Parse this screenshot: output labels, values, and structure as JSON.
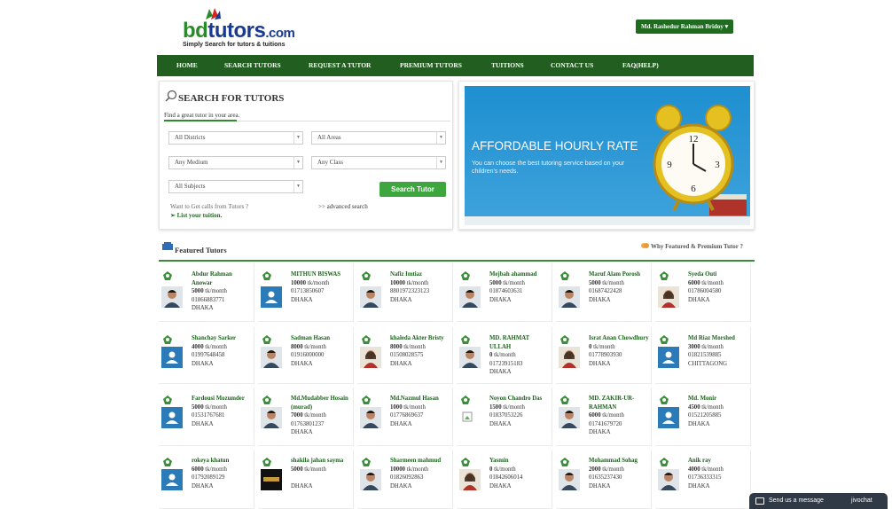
{
  "brand": {
    "name_part1": "bd",
    "name_part2": "tutors",
    "name_part3": ".com",
    "tagline": "Simply Search for tutors & tuitions"
  },
  "user": {
    "name": "Md. Rashedur Rahman Bridoy",
    "caret": "▾"
  },
  "nav": [
    "HOME",
    "SEARCH TUTORS",
    "REQUEST A TUTOR",
    "PREMIUM TUTORS",
    "TUITIONS",
    "CONTACT US",
    "FAQ(HELP)"
  ],
  "search": {
    "title": "SEARCH FOR TUTORS",
    "subtitle": "Find a great tutor in your area.",
    "district": "All Districts",
    "area": "All Areas",
    "medium": "Any Medium",
    "class": "Any Class",
    "subjects": "All Subjects",
    "button": "Search Tutor",
    "want_calls": "Want to Get calls from Tutors ?",
    "advanced": ">> advanced search",
    "list_tuition": "List your tuition."
  },
  "banner": {
    "title": "AFFORDABLE HOURLY RATE",
    "subtitle": "You can choose the best tutoring service based on your children's needs."
  },
  "featured": {
    "title": "Featured Tutors",
    "why": "Why Featured & Premium Tutor ?"
  },
  "tutors": [
    {
      "name": "Abdur Rahman Anowar",
      "rate": "5000",
      "unit": "tk/month",
      "phone": "01866883771",
      "city": "DHAKA",
      "photo": "man-photo"
    },
    {
      "name": "MITHUN BISWAS",
      "rate": "10000",
      "unit": "tk/month",
      "phone": "01713850607",
      "city": "DHAKA",
      "photo": "default-avatar"
    },
    {
      "name": "Nafiz Imtiaz",
      "rate": "10000",
      "unit": "tk/month",
      "phone": "8801972323123",
      "city": "DHAKA",
      "photo": "man-photo"
    },
    {
      "name": "Mejbah ahammad",
      "rate": "5000",
      "unit": "tk/month",
      "phone": "01874603631",
      "city": "DHAKA",
      "photo": "man-photo"
    },
    {
      "name": "Maruf Alam Porosh",
      "rate": "5000",
      "unit": "tk/month",
      "phone": "01687422428",
      "city": "DHAKA",
      "photo": "man-photo"
    },
    {
      "name": "Syeda Outi",
      "rate": "6000",
      "unit": "tk/month",
      "phone": "01786004580",
      "city": "DHAKA",
      "photo": "woman-photo"
    },
    {
      "name": "Shanchay Sarker",
      "rate": "4000",
      "unit": "tk/month",
      "phone": "01997648458",
      "city": "DHAKA",
      "photo": "default-avatar"
    },
    {
      "name": "Sadman Hasan",
      "rate": "8000",
      "unit": "tk/month",
      "phone": "01916000000",
      "city": "DHAKA",
      "photo": "man-photo"
    },
    {
      "name": "khaleda Akter Bristy",
      "rate": "8000",
      "unit": "tk/month",
      "phone": "01508028575",
      "city": "DHAKA",
      "photo": "woman-photo"
    },
    {
      "name": "MD. RAHMAT ULLAH",
      "rate": "0",
      "unit": "tk/month",
      "phone": "01723915183",
      "city": "DHAKA",
      "photo": "man-photo"
    },
    {
      "name": "Israt Anan Chowdhury",
      "rate": "0",
      "unit": "tk/month",
      "phone": "01778903930",
      "city": "DHAKA",
      "photo": "woman-photo"
    },
    {
      "name": "Md Riaz Morshed",
      "rate": "3000",
      "unit": "tk/month",
      "phone": "01821539885",
      "city": "CHITTAGONG",
      "photo": "default-avatar"
    },
    {
      "name": "Fardousi Mozumder",
      "rate": "5000",
      "unit": "tk/month",
      "phone": "01531767681",
      "city": "DHAKA",
      "photo": "default-avatar"
    },
    {
      "name": "Md.Mudabber Hosain (murad)",
      "rate": "7000",
      "unit": "tk/month",
      "phone": "01763801237",
      "city": "DHAKA",
      "photo": "man-photo"
    },
    {
      "name": "Md.Nazmul Hasan",
      "rate": "1000",
      "unit": "tk/month",
      "phone": "01776869637",
      "city": "DHAKA",
      "photo": "man-photo"
    },
    {
      "name": "Noyon Chandro Das",
      "rate": "1500",
      "unit": "tk/month",
      "phone": "01837053226",
      "city": "DHAKA",
      "photo": "broken-image"
    },
    {
      "name": "MD. ZAKIR-UR-RAHMAN",
      "rate": "6000",
      "unit": "tk/month",
      "phone": "01741679720",
      "city": "DHAKA",
      "photo": "man-photo"
    },
    {
      "name": "Md. Monir",
      "rate": "4500",
      "unit": "tk/month",
      "phone": "01521205885",
      "city": "DHAKA",
      "photo": "default-avatar"
    },
    {
      "name": "rokeya khatun",
      "rate": "6000",
      "unit": "tk/month",
      "phone": "01792089129",
      "city": "DHAKA",
      "photo": "default-avatar"
    },
    {
      "name": "shakila jahan sayma",
      "rate": "5000",
      "unit": "tk/month",
      "phone": "",
      "city": "DHAKA",
      "photo": "logo-photo"
    },
    {
      "name": "Sharmeen mahmud",
      "rate": "10000",
      "unit": "tk/month",
      "phone": "01826092863",
      "city": "DHAKA",
      "photo": "man-photo"
    },
    {
      "name": "Yasmin",
      "rate": "0",
      "unit": "tk/month",
      "phone": "01842606014",
      "city": "DHAKA",
      "photo": "woman-photo"
    },
    {
      "name": "Mohammad Sohag",
      "rate": "2000",
      "unit": "tk/month",
      "phone": "01635237430",
      "city": "DHAKA",
      "photo": "man-photo"
    },
    {
      "name": "Anik ray",
      "rate": "4000",
      "unit": "tk/month",
      "phone": "01736333315",
      "city": "DHAKA",
      "photo": "man-photo"
    }
  ],
  "chat": {
    "label": "Send us a message",
    "brand": "jivochat"
  },
  "colors": {
    "nav_green": "#215e1f",
    "accent_green": "#3ea63e",
    "banner_blue": "#1e8fd0",
    "name_green": "#1f5f1f"
  }
}
